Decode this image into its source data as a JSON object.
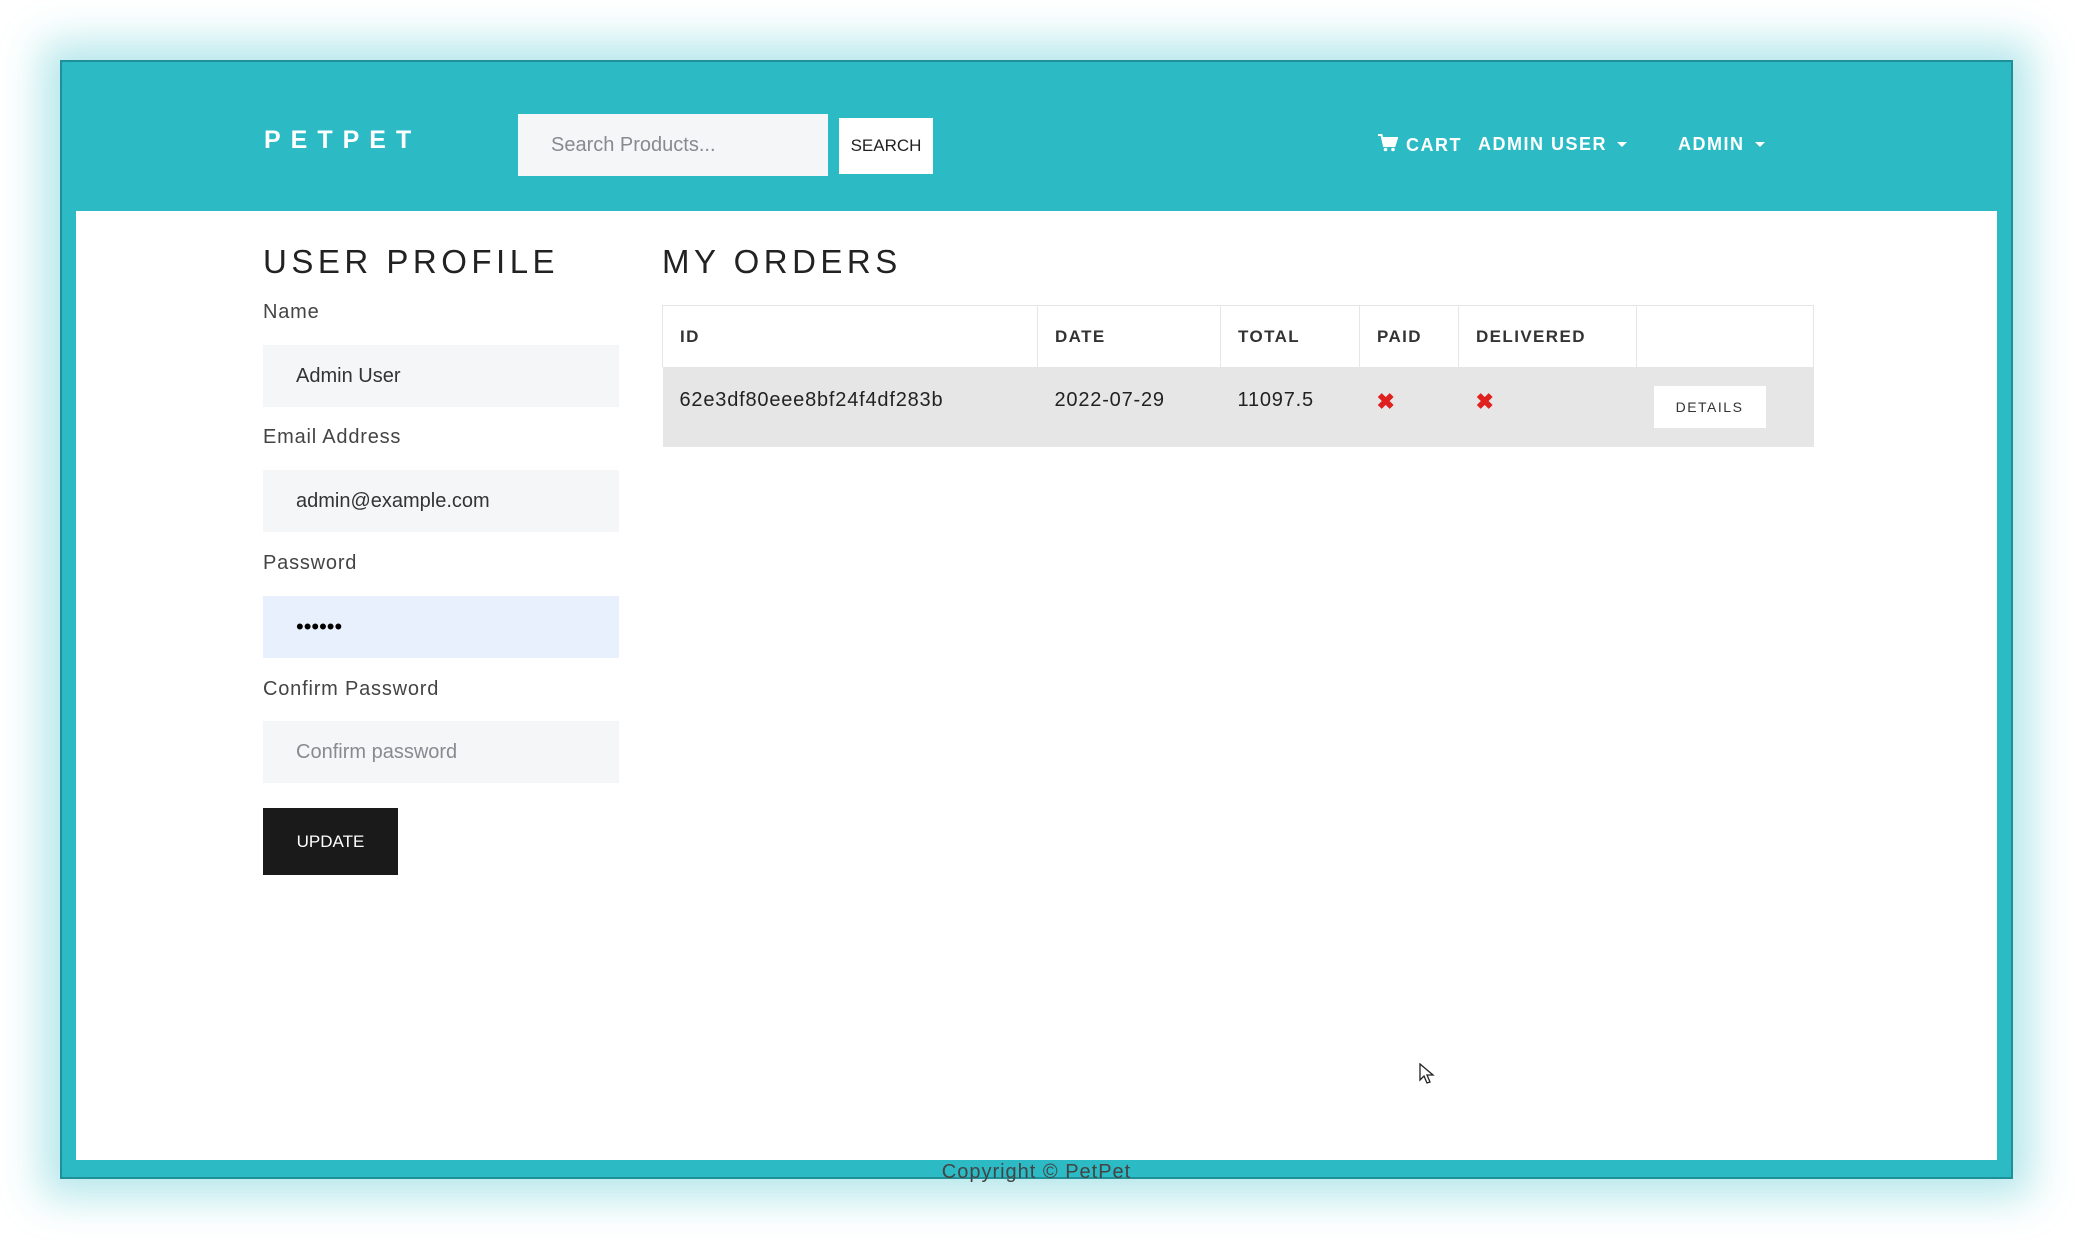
{
  "navbar": {
    "brand": "PETPET",
    "search": {
      "placeholder": "Search Products...",
      "button_label": "SEARCH"
    },
    "links": {
      "cart": "CART",
      "user": "ADMIN USER",
      "admin": "ADMIN"
    },
    "icons": {
      "cart": "shopping-cart-icon",
      "dropdown": "caret-down-icon"
    }
  },
  "profile": {
    "title": "USER PROFILE",
    "fields": {
      "name": {
        "label": "Name",
        "value": "Admin User"
      },
      "email": {
        "label": "Email Address",
        "value": "admin@example.com"
      },
      "password": {
        "label": "Password",
        "value": "••••••"
      },
      "confirm_password": {
        "label": "Confirm Password",
        "placeholder": "Confirm password"
      }
    },
    "update_label": "UPDATE"
  },
  "orders": {
    "title": "MY ORDERS",
    "columns": [
      "ID",
      "DATE",
      "TOTAL",
      "PAID",
      "DELIVERED",
      ""
    ],
    "rows": [
      {
        "id": "62e3df80eee8bf24f4df283b",
        "date": "2022-07-29",
        "total": "11097.5",
        "paid": "✖",
        "delivered": "✖",
        "action": "DETAILS"
      }
    ]
  },
  "footer": {
    "copyright": "Copyright © PetPet"
  },
  "colors": {
    "accent": "#2cbac5",
    "dark_button": "#1a1a1a",
    "not_done": "#e0201e",
    "row_bg": "#e6e6e6"
  }
}
